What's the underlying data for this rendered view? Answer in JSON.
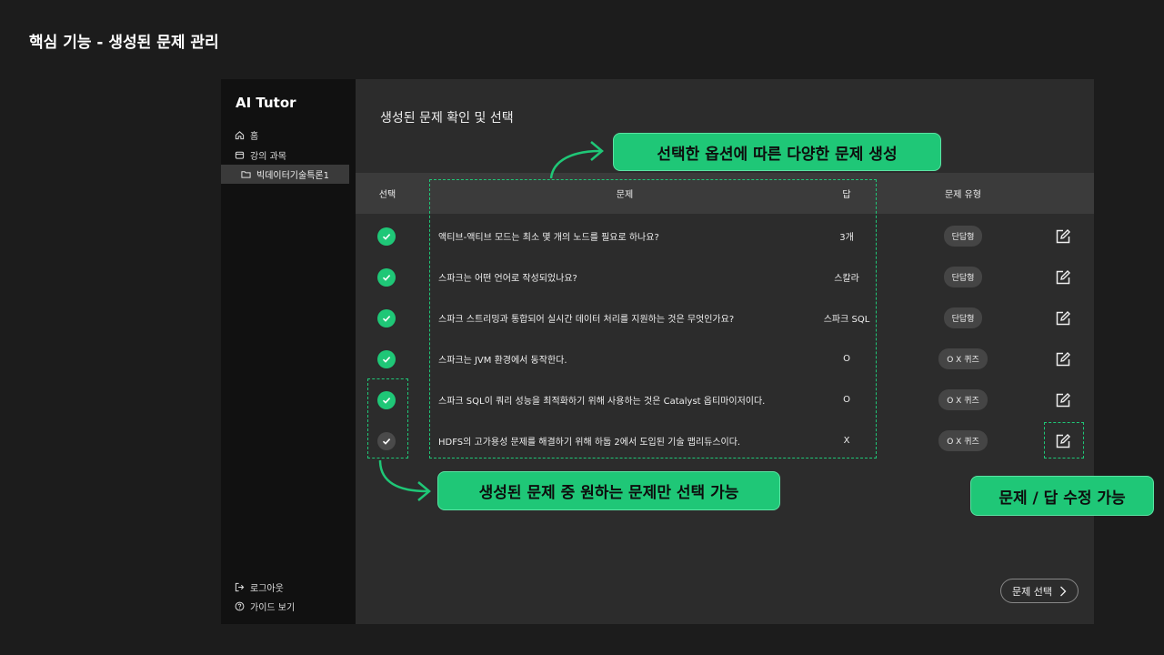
{
  "slide_title": "핵심 기능 - 생성된 문제 관리",
  "sidebar": {
    "brand": "AI Tutor",
    "home_label": "홈",
    "courses_label": "강의 과목",
    "course_item": "빅데이터기술특론1",
    "logout_label": "로그아웃",
    "guide_label": "가이드 보기"
  },
  "main": {
    "title": "생성된 문제 확인 및 선택",
    "columns": [
      "선택",
      "문제",
      "답",
      "문제 유형"
    ],
    "rows": [
      {
        "selected": true,
        "question": "액티브-액티브 모드는 최소 몇 개의 노드를 필요로 하나요?",
        "answer": "3개",
        "type": "단답형"
      },
      {
        "selected": true,
        "question": "스파크는 어떤 언어로 작성되었나요?",
        "answer": "스칼라",
        "type": "단답형"
      },
      {
        "selected": true,
        "question": "스파크 스트리밍과 통합되어 실시간 데이터 처리를 지원하는 것은 무엇인가요?",
        "answer": "스파크 SQL",
        "type": "단답형"
      },
      {
        "selected": true,
        "question": "스파크는 JVM 환경에서 동작한다.",
        "answer": "O",
        "type": "O X 퀴즈"
      },
      {
        "selected": true,
        "question": "스파크 SQL이 쿼리 성능을 최적화하기 위해 사용하는 것은 Catalyst 옵티마이저이다.",
        "answer": "O",
        "type": "O X 퀴즈"
      },
      {
        "selected": false,
        "question": "HDFS의 고가용성 문제를 해결하기 위해 하둡 2에서 도입된 기술 맵리듀스이다.",
        "answer": "X",
        "type": "O X 퀴즈"
      }
    ],
    "select_button": "문제 선택"
  },
  "callouts": {
    "top": "선택한 옵션에 따른 다양한 문제 생성",
    "left": "생성된 문제 중 원하는 문제만 선택 가능",
    "right": "문제 / 답 수정 가능"
  },
  "colors": {
    "accent": "#1fc777",
    "background": "#1c1c1c",
    "panel": "#2c2c2c",
    "sidebar": "#111111"
  }
}
